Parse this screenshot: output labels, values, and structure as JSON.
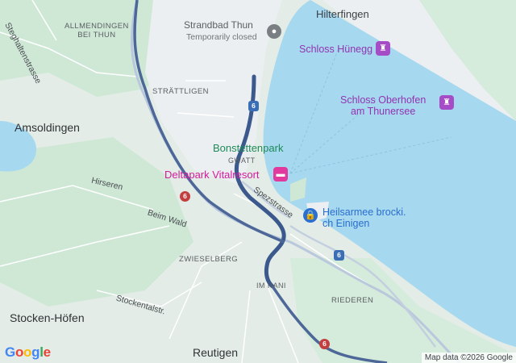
{
  "map": {
    "places": {
      "hilterfingen": "Hilterfingen",
      "allmendingen": "ALLMENDINGEN\nBEI THUN",
      "strattligen": "STRÄTTLIGEN",
      "gwatt": "GWATT",
      "zwieselberg": "ZWIESELBERG",
      "im_hani": "IM HANI",
      "riederen": "RIEDEREN",
      "amsoldingen": "Amsoldingen",
      "stocken_hofen": "Stocken-Höfen",
      "reutigen": "Reutigen"
    },
    "streets": {
      "steghaltenstrasse": "Steghaltenstrasse",
      "hirseren": "Hirseren",
      "beim_wald": "Beim Wald",
      "stockentalstr": "Stockentalstr.",
      "spezstrasse": "Spezstrasse"
    },
    "pois": {
      "strandbad_name": "Strandbad Thun",
      "strandbad_status": "Temporarily closed",
      "schloss_huenegg": "Schloss Hünegg",
      "schloss_oberhofen": "Schloss Oberhofen\nam Thunersee",
      "bonstettenpark": "Bonstettenpark",
      "deltapark": "Deltapark Vitalresort",
      "heilsarmee": "Heilsarmee brocki.\nch Einigen"
    },
    "route_shields": {
      "a6_label": "6",
      "r6_label": "6"
    },
    "colors": {
      "land": "#e3ece6",
      "forest": "#c9e6d2",
      "water": "#a6d8ef",
      "urban": "#eef0f2",
      "route": "#4c6798",
      "highway": "#a7bad3"
    },
    "icons": [
      "lock-icon",
      "castle-icon",
      "tower-icon",
      "park-icon",
      "hotel-icon",
      "store-icon"
    ],
    "logo": "Google",
    "attribution": "Map data ©2026 Google"
  }
}
